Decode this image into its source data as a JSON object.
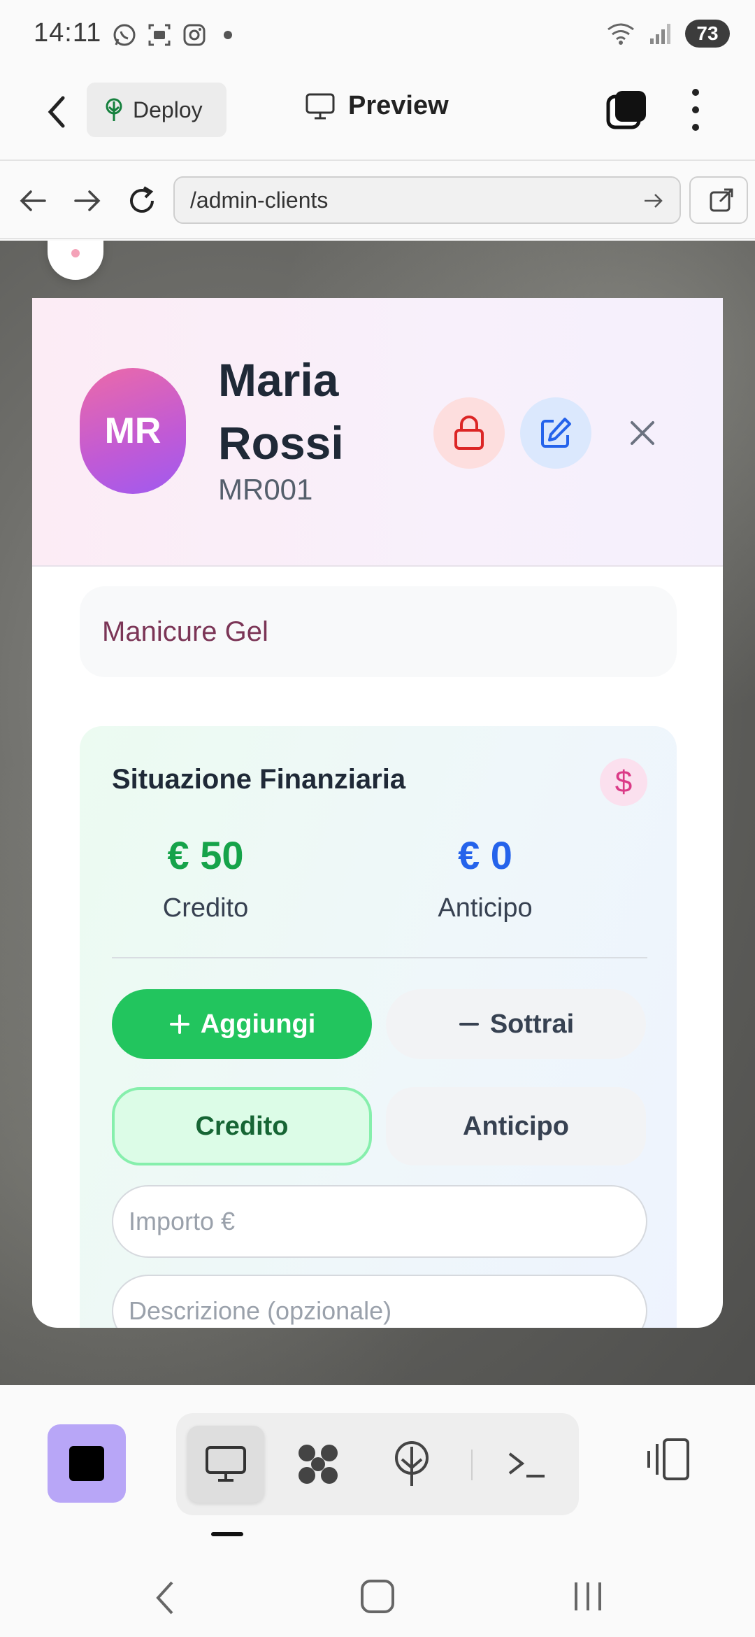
{
  "status_bar": {
    "time": "14:11",
    "battery": "73",
    "icons": [
      "whatsapp-icon",
      "screenshot-icon",
      "instagram-icon",
      "dot-icon",
      "wifi-icon",
      "signal-icon"
    ]
  },
  "app_bar": {
    "deploy_label": "Deploy",
    "preview_label": "Preview"
  },
  "browser": {
    "url": "/admin-clients"
  },
  "client": {
    "initials": "MR",
    "name": "Maria Rossi",
    "code": "MR001",
    "service": "Manicure Gel"
  },
  "finance": {
    "title": "Situazione Finanziaria",
    "currency_icon": "$",
    "credit_amount": "€ 50",
    "credit_label": "Credito",
    "advance_amount": "€ 0",
    "advance_label": "Anticipo",
    "add_label": "Aggiungi",
    "subtract_label": "Sottrai",
    "toggle_credit": "Credito",
    "toggle_advance": "Anticipo",
    "amount_placeholder": "Importo €",
    "description_placeholder": "Descrizione (opzionale)"
  },
  "colors": {
    "credit": "#16a34a",
    "advance": "#2563eb",
    "add_button": "#22c55e",
    "avatar_gradient_start": "#ec6aa8",
    "avatar_gradient_end": "#9f5af0",
    "stop_button": "#b8a6f7"
  }
}
